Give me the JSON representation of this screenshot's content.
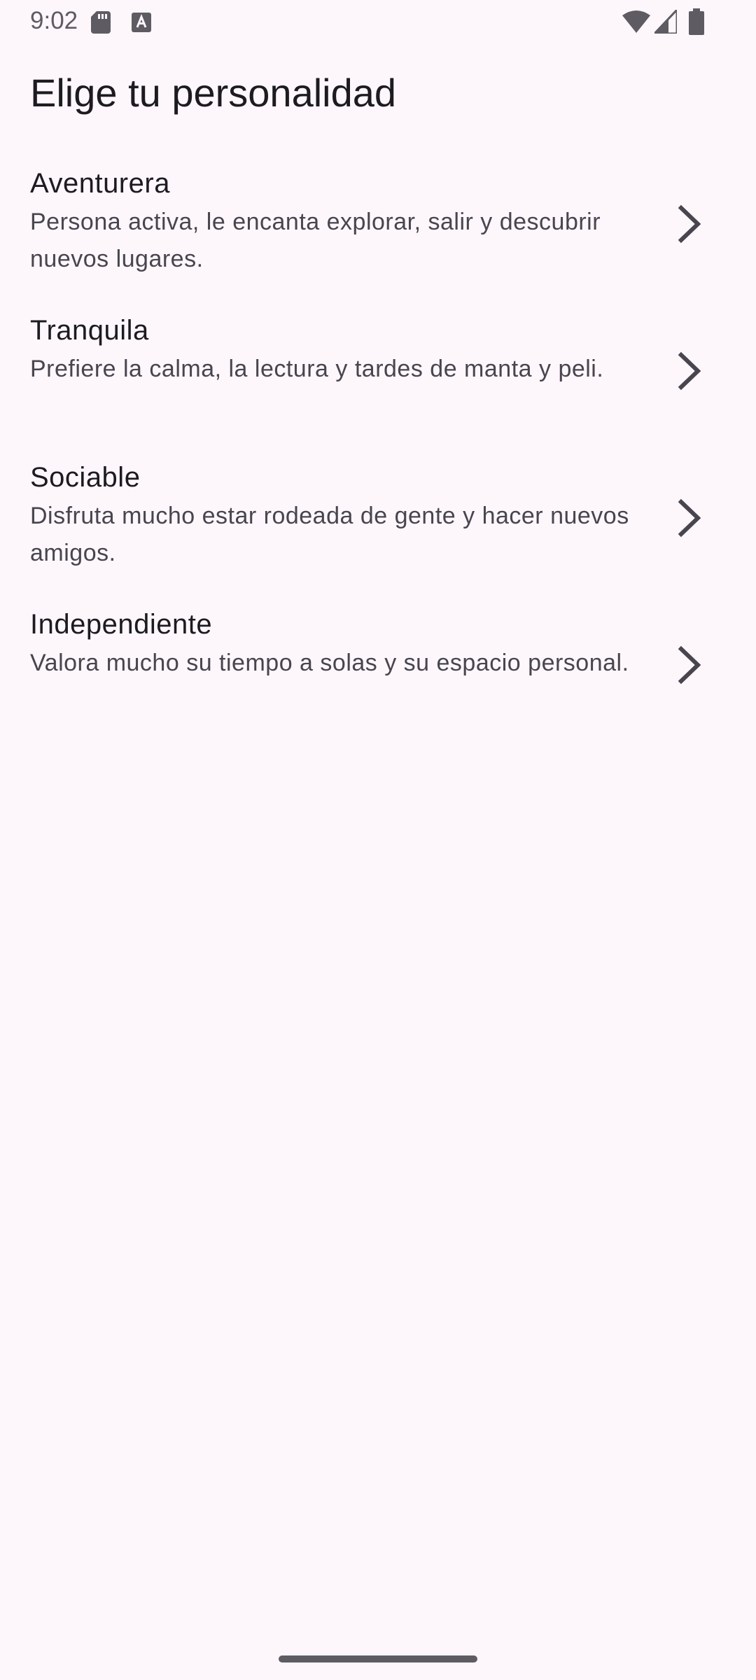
{
  "status_bar": {
    "time": "9:02",
    "icons": [
      "sd-card-icon",
      "text-a-icon",
      "wifi-icon",
      "signal-icon",
      "battery-icon"
    ]
  },
  "page": {
    "title": "Elige tu personalidad"
  },
  "personality_list": {
    "items": [
      {
        "title": "Aventurera",
        "description": "Persona activa, le encanta explorar, salir y descubrir nuevos lugares."
      },
      {
        "title": "Tranquila",
        "description": "Prefiere la calma, la lectura y tardes de manta y peli."
      },
      {
        "title": "Sociable",
        "description": "Disfruta mucho estar rodeada de gente y hacer nuevos amigos."
      },
      {
        "title": "Independiente",
        "description": "Valora mucho su tiempo a solas y su espacio personal."
      }
    ]
  },
  "colors": {
    "background": "#fdf7fc",
    "title_text": "#1d1b20",
    "secondary_text": "#49454f",
    "icon": "#49454f"
  }
}
